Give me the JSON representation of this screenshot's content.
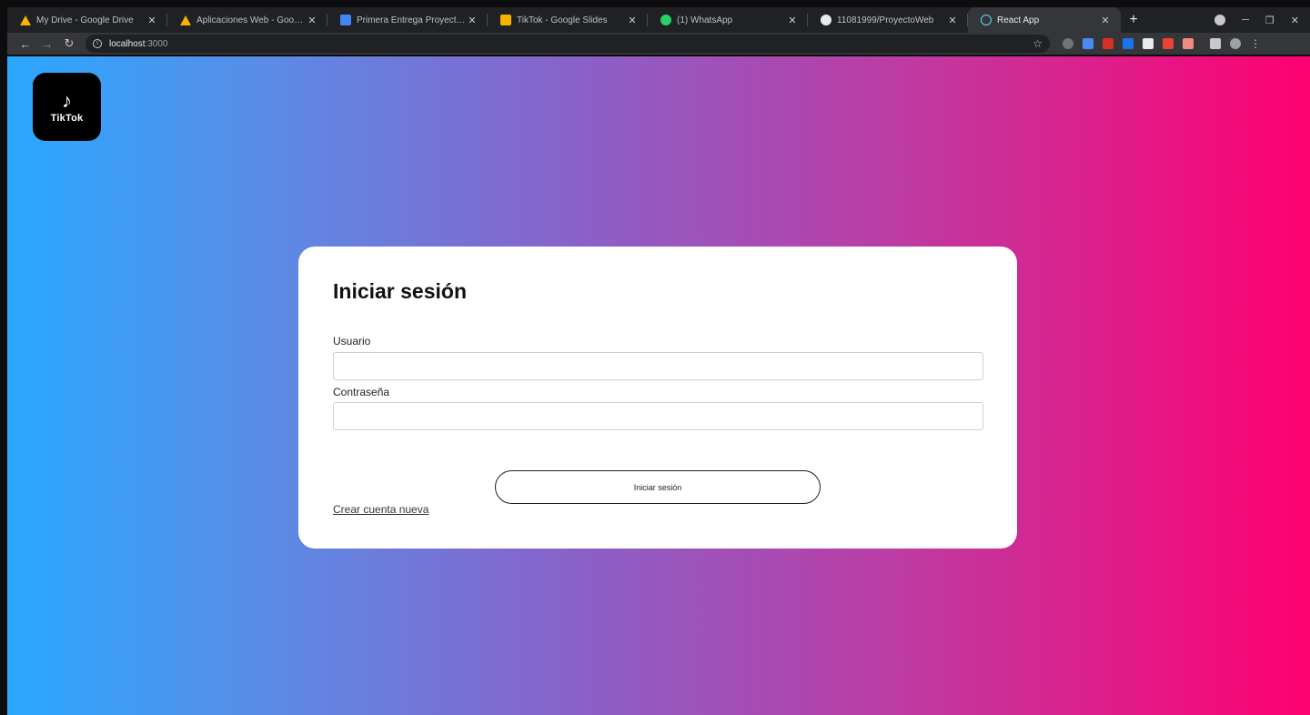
{
  "browser": {
    "tabs": [
      {
        "title": "My Drive - Google Drive",
        "icon": "google-drive-icon",
        "active": false
      },
      {
        "title": "Aplicaciones Web - Google Drive",
        "icon": "google-drive-icon",
        "active": false
      },
      {
        "title": "Primera Entrega Proyecto - Google Docs",
        "icon": "google-docs-icon",
        "active": false
      },
      {
        "title": "TikTok - Google Slides",
        "icon": "google-slides-icon",
        "active": false
      },
      {
        "title": "(1) WhatsApp",
        "icon": "whatsapp-icon",
        "active": false
      },
      {
        "title": "11081999/ProyectoWeb",
        "icon": "github-icon",
        "active": false
      },
      {
        "title": "React App",
        "icon": "react-icon",
        "active": true
      }
    ],
    "close_glyph": "✕",
    "new_tab_glyph": "+",
    "url_host": "localhost",
    "url_port": ":3000",
    "minimize_glyph": "─",
    "restore_glyph": "❐",
    "window_close_glyph": "✕"
  },
  "app": {
    "logo_glyph": "♪",
    "logo_text": "TikTok",
    "login": {
      "title": "Iniciar sesión",
      "username_label": "Usuario",
      "username_value": "",
      "password_label": "Contraseña",
      "password_value": "",
      "submit_label": "Iniciar sesión",
      "create_account_link": "Crear cuenta nueva"
    }
  },
  "colors": {
    "gradient_start": "#2aa8ff",
    "gradient_end": "#ff0070",
    "card_bg": "#ffffff"
  }
}
